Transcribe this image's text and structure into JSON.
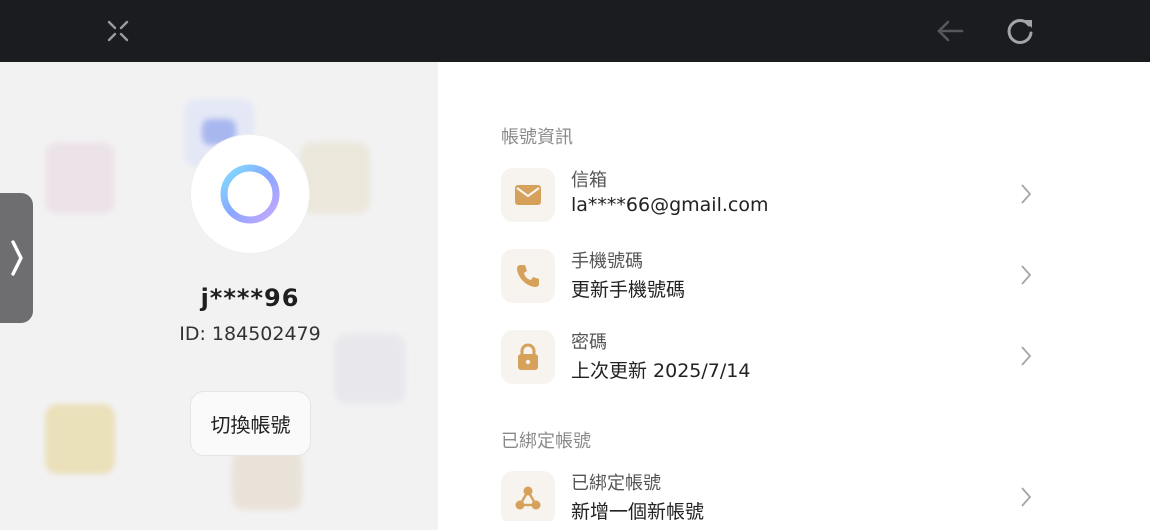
{
  "topbar": {
    "close_icon": "collapse-x-icon",
    "back_icon": "arrow-left-icon",
    "refresh_icon": "refresh-icon"
  },
  "profile": {
    "username": "j****96",
    "id_text": "ID: 184502479",
    "switch_label": "切換帳號"
  },
  "account_info": {
    "section_title": "帳號資訊",
    "items": [
      {
        "label": "信箱",
        "value": "la****66@gmail.com",
        "icon": "envelope-icon"
      },
      {
        "label": "手機號碼",
        "value": "更新手機號碼",
        "icon": "phone-icon"
      },
      {
        "label": "密碼",
        "value": "上次更新 2025/7/14",
        "icon": "lock-icon"
      }
    ]
  },
  "linked": {
    "section_title": "已綁定帳號",
    "items": [
      {
        "label": "已綁定帳號",
        "value": "新增一個新帳號",
        "icon": "link-nodes-icon"
      }
    ]
  },
  "colors": {
    "accent": "#d6a15a",
    "topbar": "#1b1c20"
  }
}
